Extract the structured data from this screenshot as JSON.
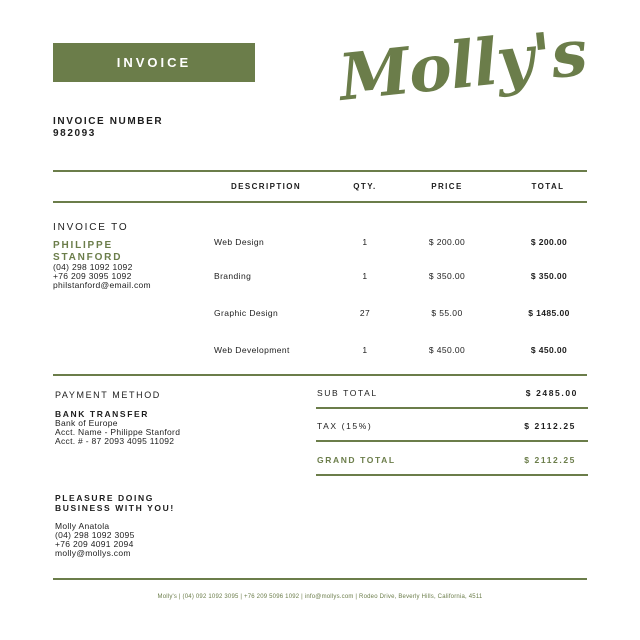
{
  "header": {
    "badge": "INVOICE",
    "brand": "Molly's",
    "invoice_number_label": "INVOICE NUMBER",
    "invoice_number": "982093"
  },
  "table": {
    "headers": [
      "DESCRIPTION",
      "QTY.",
      "PRICE",
      "TOTAL"
    ],
    "rows": [
      {
        "description": "Web Design",
        "qty": "1",
        "price": "$ 200.00",
        "total": "$ 200.00"
      },
      {
        "description": "Branding",
        "qty": "1",
        "price": "$ 350.00",
        "total": "$ 350.00"
      },
      {
        "description": "Graphic Design",
        "qty": "27",
        "price": "$ 55.00",
        "total": "$ 1485.00"
      },
      {
        "description": "Web Development",
        "qty": "1",
        "price": "$ 450.00",
        "total": "$ 450.00"
      }
    ]
  },
  "invoice_to": {
    "label": "INVOICE TO",
    "name_line1": "PHILIPPE",
    "name_line2": "STANFORD",
    "phone1": "(04) 298 1092 1092",
    "phone2": "+76 209 3095 1092",
    "email": "philstanford@email.com"
  },
  "payment": {
    "label": "PAYMENT METHOD",
    "method": "BANK TRANSFER",
    "bank": "Bank of Europe",
    "acct_name": "Acct. Name - Philippe Stanford",
    "acct_no": "Acct. # - 87 2093 4095 11092"
  },
  "totals": {
    "subtotal_label": "SUB TOTAL",
    "subtotal": "$ 2485.00",
    "tax_label": "TAX (15%)",
    "tax": "$ 2112.25",
    "grand_label": "GRAND TOTAL",
    "grand": "$ 2112.25"
  },
  "closing": {
    "line1": "PLEASURE DOING",
    "line2": "BUSINESS WITH YOU!",
    "name": "Molly Anatola",
    "phone1": "(04) 298 1092 3095",
    "phone2": "+76 209 4091 2094",
    "email": "molly@mollys.com"
  },
  "footer": {
    "text": "Molly's | (04) 092 1092 3095 | +76 209 5096 1092 | info@mollys.com | Rodeo Drive, Beverly Hills, California, 4511"
  },
  "colors": {
    "accent": "#6b7d4a",
    "text": "#1d1d1d",
    "background": "#ffffff"
  }
}
